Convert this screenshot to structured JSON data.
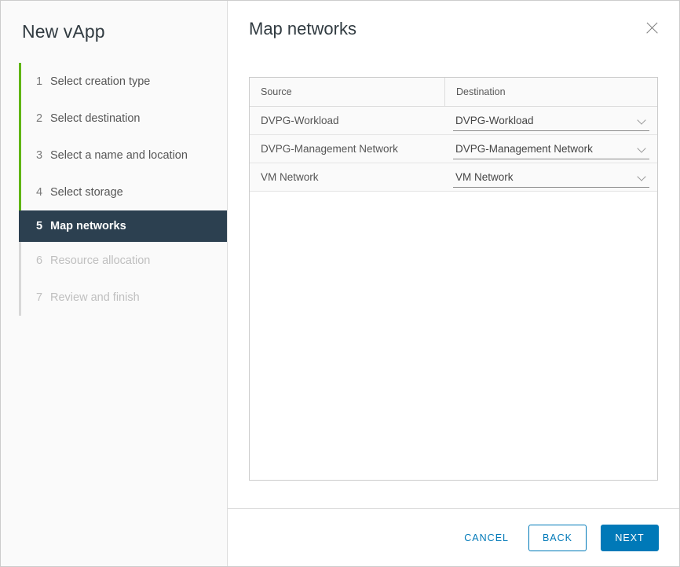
{
  "sidebar": {
    "title": "New vApp",
    "steps": [
      {
        "num": "1",
        "label": "Select creation type",
        "state": "done"
      },
      {
        "num": "2",
        "label": "Select destination",
        "state": "done"
      },
      {
        "num": "3",
        "label": "Select a name and location",
        "state": "done"
      },
      {
        "num": "4",
        "label": "Select storage",
        "state": "done"
      },
      {
        "num": "5",
        "label": "Map networks",
        "state": "active"
      },
      {
        "num": "6",
        "label": "Resource allocation",
        "state": "disabled"
      },
      {
        "num": "7",
        "label": "Review and finish",
        "state": "disabled"
      }
    ]
  },
  "header": {
    "title": "Map networks",
    "close_icon": "close-icon"
  },
  "table": {
    "columns": [
      "Source",
      "Destination"
    ],
    "rows": [
      {
        "source": "DVPG-Workload",
        "destination": "DVPG-Workload"
      },
      {
        "source": "DVPG-Management Network",
        "destination": "DVPG-Management Network"
      },
      {
        "source": "VM Network",
        "destination": "VM Network"
      }
    ]
  },
  "footer": {
    "cancel_label": "CANCEL",
    "back_label": "BACK",
    "next_label": "NEXT"
  },
  "colors": {
    "accent_blue": "#0079b8",
    "progress_green": "#60b515",
    "active_step_bg": "#2c4050"
  }
}
